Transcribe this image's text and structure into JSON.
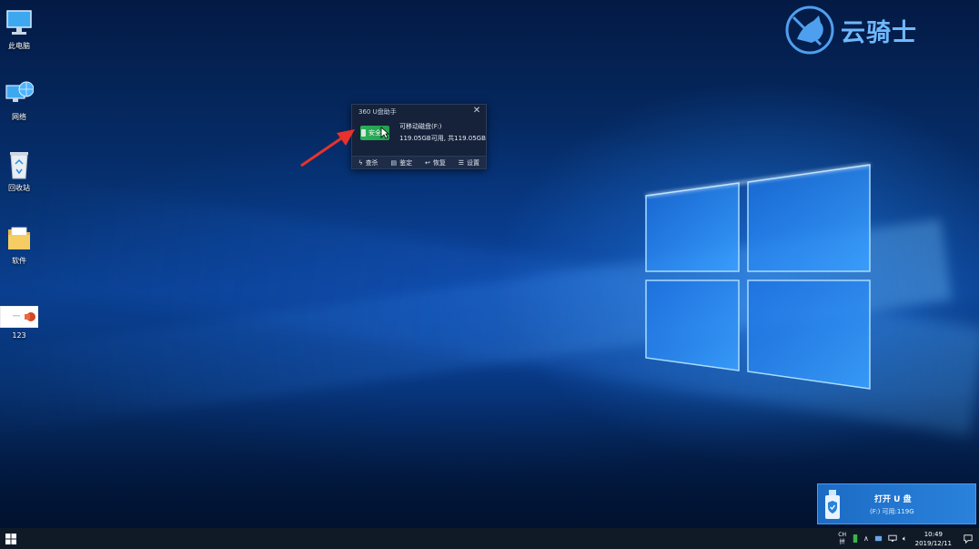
{
  "desktop": {
    "icons": [
      {
        "label": "此电脑",
        "icon": "computer-icon"
      },
      {
        "label": "网络",
        "icon": "network-icon"
      },
      {
        "label": "回收站",
        "icon": "recycle-bin-icon"
      },
      {
        "label": "软件",
        "icon": "folder-icon"
      },
      {
        "label": "123",
        "icon": "powerpoint-file-icon"
      }
    ]
  },
  "brand": {
    "text": "云骑士",
    "icon": "knight-logo-icon",
    "color": "#6fb8ff"
  },
  "popup": {
    "title": "360 U盘助手",
    "close_icon": "close-icon",
    "badge": "安全",
    "drive_name": "可移动磁盘(F:)",
    "drive_space": "119.05GB可用, 共119.05GB",
    "actions": [
      {
        "label": "查杀",
        "icon": "lightning-icon"
      },
      {
        "label": "鉴定",
        "icon": "document-icon"
      },
      {
        "label": "恢复",
        "icon": "restore-icon"
      },
      {
        "label": "设置",
        "icon": "list-icon"
      }
    ],
    "badge_color": "#2cb05a"
  },
  "notification": {
    "title": "打开 U 盘",
    "subtitle": "(F:) 可用:119G",
    "icon": "usb-shield-icon"
  },
  "taskbar": {
    "start_icon": "windows-start-icon",
    "ime_top": "CH",
    "ime_bottom": "拼",
    "time": "10:49",
    "date": "2019/12/11",
    "tray_icons": [
      "usb-drive-tray-icon",
      "chevron-up-icon",
      "network-tray-icon",
      "monitor-tray-icon",
      "volume-icon"
    ],
    "action_center_icon": "notification-icon"
  },
  "annotation": {
    "arrow_color": "#e8322c"
  }
}
